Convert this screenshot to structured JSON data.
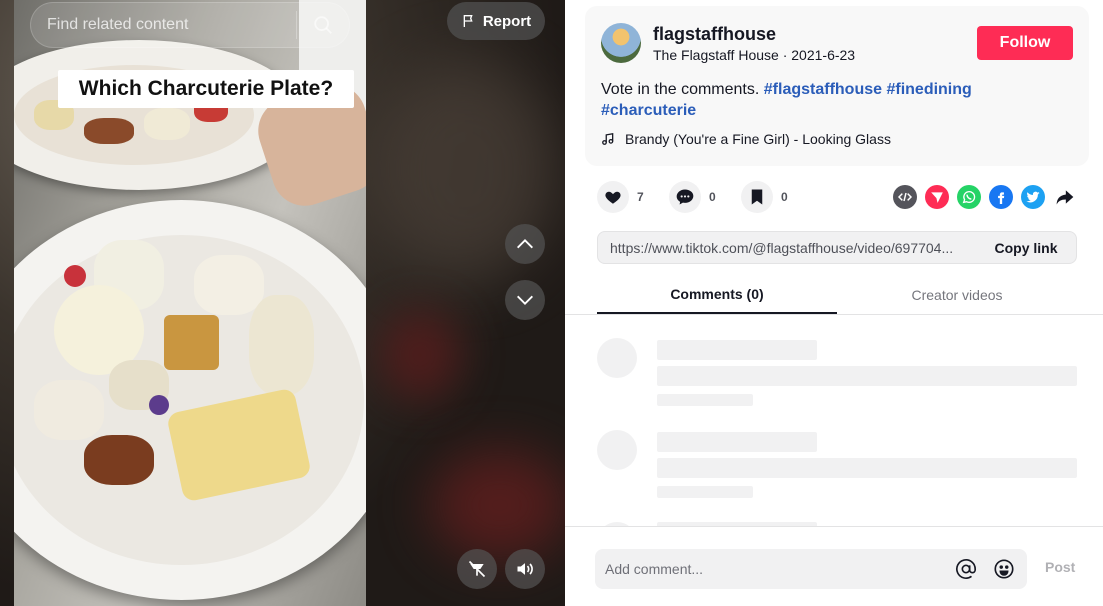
{
  "search": {
    "placeholder": "Find related content"
  },
  "video": {
    "report_label": "Report",
    "caption": "Which Charcuterie Plate?"
  },
  "author": {
    "username": "flagstaffhouse",
    "display_name": "The Flagstaff House",
    "date": "2021-6-23",
    "follow_label": "Follow"
  },
  "description": {
    "text": "Vote in the comments.",
    "hashtags": [
      "#flagstaffhouse",
      "#finedining",
      "#charcuterie"
    ]
  },
  "music": {
    "title": "Brandy (You're a Fine Girl) - Looking Glass"
  },
  "stats": {
    "likes": "7",
    "comments": "0",
    "saves": "0"
  },
  "link": {
    "url": "https://www.tiktok.com/@flagstaffhouse/video/697704...",
    "copy_label": "Copy link"
  },
  "tabs": [
    {
      "label": "Comments (0)",
      "active": true
    },
    {
      "label": "Creator videos",
      "active": false
    }
  ],
  "comment_box": {
    "placeholder": "Add comment...",
    "post_label": "Post"
  },
  "colors": {
    "accent": "#fe2c55",
    "hashtag": "#2b5db9",
    "whatsapp": "#25d366",
    "facebook": "#1877f2",
    "twitter": "#1da1f2",
    "embed": "#54545b"
  },
  "icons": {
    "search": "search-icon",
    "report": "flag-icon",
    "up": "chevron-up-icon",
    "down": "chevron-down-icon",
    "floating": "floating-player-icon",
    "volume": "volume-icon",
    "music": "music-note-icon",
    "like": "heart-icon",
    "comment": "comment-icon",
    "save": "bookmark-icon",
    "embed": "embed-icon",
    "send": "send-icon",
    "whatsapp": "whatsapp-icon",
    "facebook": "facebook-icon",
    "twitter": "twitter-icon",
    "share": "share-arrow-icon",
    "mention": "at-icon",
    "emoji": "emoji-icon"
  }
}
